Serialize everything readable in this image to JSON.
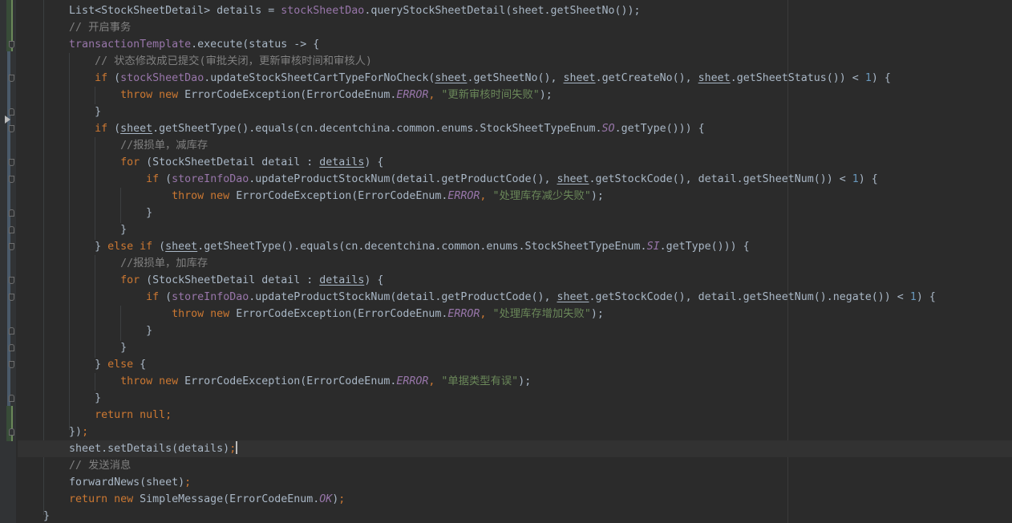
{
  "lines": [
    {
      "indent": "        ",
      "tokens": [
        {
          "t": "List<StockSheetDetail> details = ",
          "c": "t"
        },
        {
          "t": "stockSheetDao",
          "c": "t field"
        },
        {
          "t": ".queryStockSheetDetail(sheet.getSheetNo());",
          "c": "t"
        }
      ]
    },
    {
      "indent": "        ",
      "tokens": [
        {
          "t": "// 开启事务",
          "c": "t cmt"
        }
      ]
    },
    {
      "indent": "        ",
      "tokens": [
        {
          "t": "transactionTemplate",
          "c": "t field"
        },
        {
          "t": ".execute(status -> {",
          "c": "t"
        }
      ]
    },
    {
      "indent": "            ",
      "tokens": [
        {
          "t": "// 状态修改成已提交(审批关闭，更新审核时间和审核人)",
          "c": "t cmt"
        }
      ]
    },
    {
      "indent": "            ",
      "tokens": [
        {
          "t": "if ",
          "c": "t kw"
        },
        {
          "t": "(",
          "c": "t"
        },
        {
          "t": "stockSheetDao",
          "c": "t field"
        },
        {
          "t": ".updateStockSheetCartTypeForNoCheck(",
          "c": "t"
        },
        {
          "t": "sheet",
          "c": "t ul"
        },
        {
          "t": ".getSheetNo(), ",
          "c": "t"
        },
        {
          "t": "sheet",
          "c": "t ul"
        },
        {
          "t": ".getCreateNo(), ",
          "c": "t"
        },
        {
          "t": "sheet",
          "c": "t ul"
        },
        {
          "t": ".getSheetStatus()) < ",
          "c": "t"
        },
        {
          "t": "1",
          "c": "t num"
        },
        {
          "t": ") {",
          "c": "t"
        }
      ]
    },
    {
      "indent": "                ",
      "tokens": [
        {
          "t": "throw new ",
          "c": "t kw"
        },
        {
          "t": "ErrorCodeException(ErrorCodeEnum.",
          "c": "t"
        },
        {
          "t": "ERROR",
          "c": "t enumc"
        },
        {
          "t": ", ",
          "c": "t kw"
        },
        {
          "t": "\"更新审核时间失败\"",
          "c": "t str"
        },
        {
          "t": ");",
          "c": "t"
        }
      ]
    },
    {
      "indent": "            ",
      "tokens": [
        {
          "t": "}",
          "c": "t"
        }
      ]
    },
    {
      "indent": "            ",
      "tokens": [
        {
          "t": "if ",
          "c": "t kw"
        },
        {
          "t": "(",
          "c": "t"
        },
        {
          "t": "sheet",
          "c": "t ul"
        },
        {
          "t": ".getSheetType().equals(cn.decentchina.common.enums.StockSheetTypeEnum.",
          "c": "t"
        },
        {
          "t": "SO",
          "c": "t enumc"
        },
        {
          "t": ".getType())) {",
          "c": "t"
        }
      ]
    },
    {
      "indent": "                ",
      "tokens": [
        {
          "t": "//报损单，减库存",
          "c": "t cmt"
        }
      ]
    },
    {
      "indent": "                ",
      "tokens": [
        {
          "t": "for ",
          "c": "t kw"
        },
        {
          "t": "(StockSheetDetail detail : ",
          "c": "t"
        },
        {
          "t": "details",
          "c": "t ul"
        },
        {
          "t": ") {",
          "c": "t"
        }
      ]
    },
    {
      "indent": "                    ",
      "tokens": [
        {
          "t": "if ",
          "c": "t kw"
        },
        {
          "t": "(",
          "c": "t"
        },
        {
          "t": "storeInfoDao",
          "c": "t field"
        },
        {
          "t": ".updateProductStockNum(detail.getProductCode(), ",
          "c": "t"
        },
        {
          "t": "sheet",
          "c": "t ul"
        },
        {
          "t": ".getStockCode(), detail.getSheetNum()) < ",
          "c": "t"
        },
        {
          "t": "1",
          "c": "t num"
        },
        {
          "t": ") {",
          "c": "t"
        }
      ]
    },
    {
      "indent": "                        ",
      "tokens": [
        {
          "t": "throw new ",
          "c": "t kw"
        },
        {
          "t": "ErrorCodeException(ErrorCodeEnum.",
          "c": "t"
        },
        {
          "t": "ERROR",
          "c": "t enumc"
        },
        {
          "t": ", ",
          "c": "t kw"
        },
        {
          "t": "\"处理库存减少失败\"",
          "c": "t str"
        },
        {
          "t": ");",
          "c": "t"
        }
      ]
    },
    {
      "indent": "                    ",
      "tokens": [
        {
          "t": "}",
          "c": "t"
        }
      ]
    },
    {
      "indent": "                ",
      "tokens": [
        {
          "t": "}",
          "c": "t"
        }
      ]
    },
    {
      "indent": "            ",
      "tokens": [
        {
          "t": "} ",
          "c": "t"
        },
        {
          "t": "else if ",
          "c": "t kw"
        },
        {
          "t": "(",
          "c": "t"
        },
        {
          "t": "sheet",
          "c": "t ul"
        },
        {
          "t": ".getSheetType().equals(cn.decentchina.common.enums.StockSheetTypeEnum.",
          "c": "t"
        },
        {
          "t": "SI",
          "c": "t enumc"
        },
        {
          "t": ".getType())) {",
          "c": "t"
        }
      ]
    },
    {
      "indent": "                ",
      "tokens": [
        {
          "t": "//报损单，加库存",
          "c": "t cmt"
        }
      ]
    },
    {
      "indent": "                ",
      "tokens": [
        {
          "t": "for ",
          "c": "t kw"
        },
        {
          "t": "(StockSheetDetail detail : ",
          "c": "t"
        },
        {
          "t": "details",
          "c": "t ul"
        },
        {
          "t": ") {",
          "c": "t"
        }
      ]
    },
    {
      "indent": "                    ",
      "tokens": [
        {
          "t": "if ",
          "c": "t kw"
        },
        {
          "t": "(",
          "c": "t"
        },
        {
          "t": "storeInfoDao",
          "c": "t field"
        },
        {
          "t": ".updateProductStockNum(detail.getProductCode(), ",
          "c": "t"
        },
        {
          "t": "sheet",
          "c": "t ul"
        },
        {
          "t": ".getStockCode(), detail.getSheetNum().negate()) < ",
          "c": "t"
        },
        {
          "t": "1",
          "c": "t num"
        },
        {
          "t": ") {",
          "c": "t"
        }
      ]
    },
    {
      "indent": "                        ",
      "tokens": [
        {
          "t": "throw new ",
          "c": "t kw"
        },
        {
          "t": "ErrorCodeException(ErrorCodeEnum.",
          "c": "t"
        },
        {
          "t": "ERROR",
          "c": "t enumc"
        },
        {
          "t": ", ",
          "c": "t kw"
        },
        {
          "t": "\"处理库存增加失败\"",
          "c": "t str"
        },
        {
          "t": ");",
          "c": "t"
        }
      ]
    },
    {
      "indent": "                    ",
      "tokens": [
        {
          "t": "}",
          "c": "t"
        }
      ]
    },
    {
      "indent": "                ",
      "tokens": [
        {
          "t": "}",
          "c": "t"
        }
      ]
    },
    {
      "indent": "            ",
      "tokens": [
        {
          "t": "} ",
          "c": "t"
        },
        {
          "t": "else ",
          "c": "t kw"
        },
        {
          "t": "{",
          "c": "t"
        }
      ]
    },
    {
      "indent": "                ",
      "tokens": [
        {
          "t": "throw new ",
          "c": "t kw"
        },
        {
          "t": "ErrorCodeException(ErrorCodeEnum.",
          "c": "t"
        },
        {
          "t": "ERROR",
          "c": "t enumc"
        },
        {
          "t": ", ",
          "c": "t kw"
        },
        {
          "t": "\"单据类型有误\"",
          "c": "t str"
        },
        {
          "t": ");",
          "c": "t"
        }
      ]
    },
    {
      "indent": "            ",
      "tokens": [
        {
          "t": "}",
          "c": "t"
        }
      ]
    },
    {
      "indent": "            ",
      "tokens": [
        {
          "t": "return null",
          "c": "t kw"
        },
        {
          "t": ";",
          "c": "t kw"
        }
      ]
    },
    {
      "indent": "        ",
      "tokens": [
        {
          "t": "})",
          "c": "t"
        },
        {
          "t": ";",
          "c": "t kw"
        }
      ]
    },
    {
      "indent": "        ",
      "current": true,
      "cursor": true,
      "tokens": [
        {
          "t": "sheet.setDetails(details)",
          "c": "t"
        },
        {
          "t": ";",
          "c": "t kw"
        }
      ]
    },
    {
      "indent": "        ",
      "tokens": [
        {
          "t": "// 发送消息",
          "c": "t cmt"
        }
      ]
    },
    {
      "indent": "        ",
      "tokens": [
        {
          "t": "forwardNews(sheet)",
          "c": "t"
        },
        {
          "t": ";",
          "c": "t kw"
        }
      ]
    },
    {
      "indent": "        ",
      "tokens": [
        {
          "t": "return new ",
          "c": "t kw"
        },
        {
          "t": "SimpleMessage(ErrorCodeEnum.",
          "c": "t"
        },
        {
          "t": "OK",
          "c": "t enumc"
        },
        {
          "t": ")",
          "c": "t"
        },
        {
          "t": ";",
          "c": "t kw"
        }
      ]
    },
    {
      "indent": "    ",
      "tokens": [
        {
          "t": "}",
          "c": "t"
        }
      ]
    }
  ]
}
